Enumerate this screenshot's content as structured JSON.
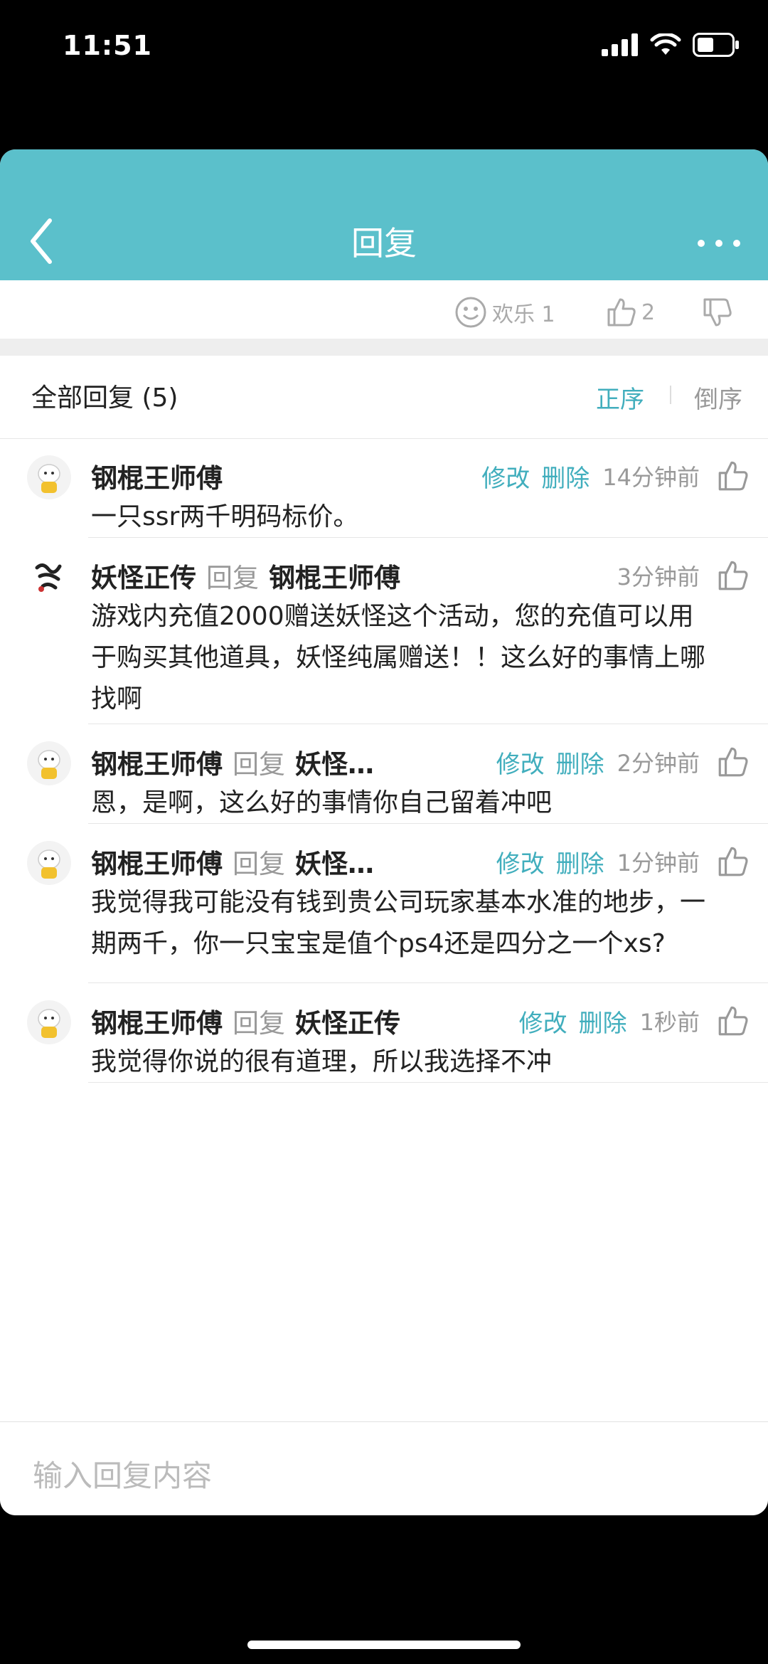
{
  "status": {
    "time": "11:51"
  },
  "nav": {
    "title": "回复"
  },
  "reactions": {
    "joy_label": "欢乐 1",
    "like_count": "2"
  },
  "sort": {
    "label": "全部回复 (5)",
    "asc": "正序",
    "desc": "倒序"
  },
  "actions": {
    "edit": "修改",
    "delete": "删除",
    "reply_word": "回复"
  },
  "replies": [
    {
      "name": "钢棍王师傅",
      "target": "",
      "time": "14分钟前",
      "text": "一只ssr两千明码标价。"
    },
    {
      "name": "妖怪正传",
      "target": "钢棍王师傅",
      "time": "3分钟前",
      "text": "游戏内充值2000赠送妖怪这个活动，您的充值可以用于购买其他道具，妖怪纯属赠送！！这么好的事情上哪找啊"
    },
    {
      "name": "钢棍王师傅",
      "target": "妖怪…",
      "time": "2分钟前",
      "text": "恩，是啊，这么好的事情你自己留着冲吧"
    },
    {
      "name": "钢棍王师傅",
      "target": "妖怪…",
      "time": "1分钟前",
      "text": "我觉得我可能没有钱到贵公司玩家基本水准的地步，一期两千，你一只宝宝是值个ps4还是四分之一个xs?"
    },
    {
      "name": "钢棍王师傅",
      "target": "妖怪正传",
      "time": "1秒前",
      "text": "我觉得你说的很有道理，所以我选择不冲"
    }
  ],
  "input": {
    "placeholder": "输入回复内容"
  }
}
